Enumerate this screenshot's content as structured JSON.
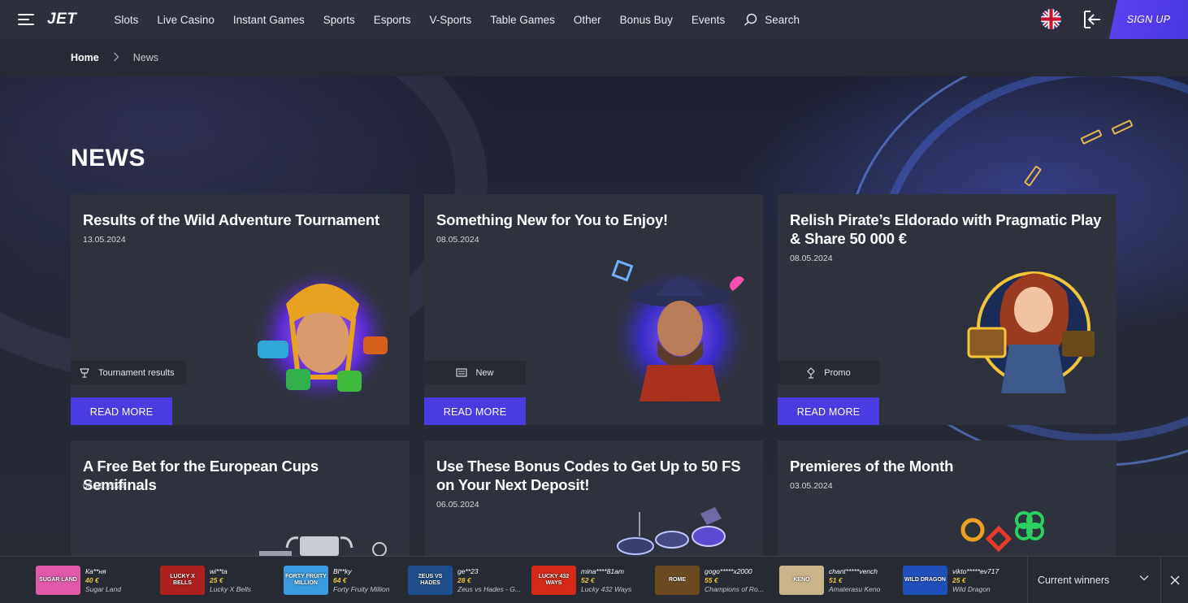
{
  "header": {
    "logo": "JET",
    "nav": [
      "Slots",
      "Live Casino",
      "Instant Games",
      "Sports",
      "Esports",
      "V-Sports",
      "Table Games",
      "Other",
      "Bonus Buy",
      "Events"
    ],
    "search_label": "Search",
    "signup_label": "SIGN UP",
    "language_icon": "uk-flag-icon",
    "login_icon": "login-icon"
  },
  "breadcrumb": {
    "home": "Home",
    "separator": ">",
    "current": "News"
  },
  "page": {
    "title": "NEWS"
  },
  "cards": [
    {
      "title": "Results of the Wild Adventure Tournament",
      "date": "13.05.2024",
      "tag": "Tournament results",
      "tag_icon": "trophy-icon",
      "button": "READ MORE"
    },
    {
      "title": "Something New for You to Enjoy!",
      "date": "08.05.2024",
      "tag": "New",
      "tag_icon": "news-icon",
      "button": "READ MORE"
    },
    {
      "title": "Relish Pirate’s Eldorado with Pragmatic Play & Share 50 000 €",
      "date": "08.05.2024",
      "tag": "Promo",
      "tag_icon": "promo-icon",
      "button": "READ MORE"
    },
    {
      "title": "A Free Bet for the European Cups Semifinals",
      "date": "06.05.2024"
    },
    {
      "title": "Use These Bonus Codes to Get Up to 50 FS on Your Next Deposit!",
      "date": "06.05.2024"
    },
    {
      "title": "Premieres of the Month",
      "date": "03.05.2024"
    }
  ],
  "winners": {
    "label": "Current winners",
    "items": [
      {
        "name": "Ка**ня",
        "amount": "40 €",
        "game": "Sugar Land",
        "thumb_text": "SUGAR LAND",
        "color": "#e05aa8"
      },
      {
        "name": "wi**ta",
        "amount": "25 €",
        "game": "Lucky X Bells",
        "thumb_text": "LUCKY X BELLS",
        "color": "#b0201e"
      },
      {
        "name": "Bl**ky",
        "amount": "64 €",
        "game": "Forty Fruity Million",
        "thumb_text": "FORTY FRUITY MILLION",
        "color": "#3a9be0"
      },
      {
        "name": "ge**23",
        "amount": "28 €",
        "game": "Zeus vs Hades - G...",
        "thumb_text": "ZEUS VS HADES",
        "color": "#1e4f8c"
      },
      {
        "name": "mina****81am",
        "amount": "52 €",
        "game": "Lucky 432 Ways",
        "thumb_text": "LUCKY 432 WAYS",
        "color": "#d62a18"
      },
      {
        "name": "gogo*****x2000",
        "amount": "55 €",
        "game": "Champions of Ro...",
        "thumb_text": "ROME",
        "color": "#6b4a22"
      },
      {
        "name": "chant*****vench",
        "amount": "51 €",
        "game": "Amaterasu Keno",
        "thumb_text": "KENO",
        "color": "#c9b48a"
      },
      {
        "name": "vikto*****ev717",
        "amount": "25 €",
        "game": "Wild Dragon",
        "thumb_text": "WILD DRAGON",
        "color": "#1f4fb8"
      }
    ]
  }
}
